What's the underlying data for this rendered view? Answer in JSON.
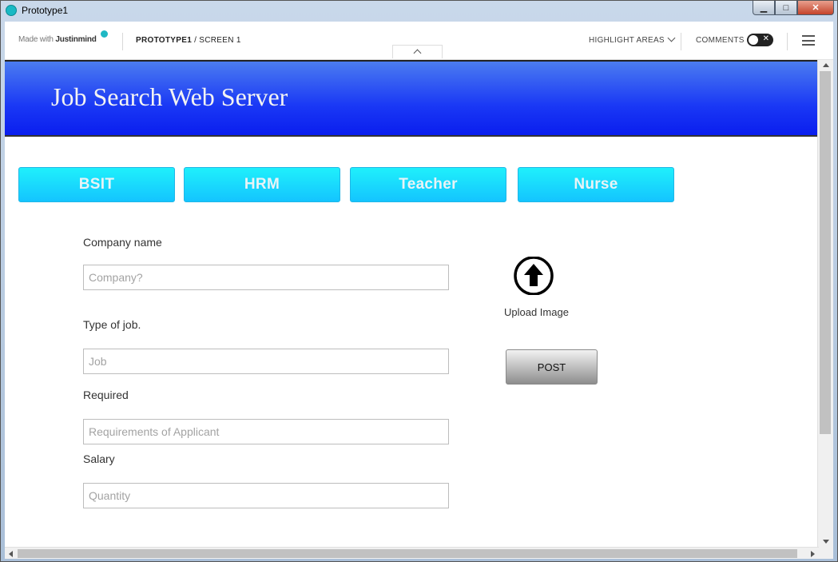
{
  "window": {
    "title": "Prototype1",
    "minimize_glyph": "▁",
    "maximize_glyph": "□",
    "close_glyph": "✕"
  },
  "toolbar": {
    "made_with": "Made with ",
    "brand": "Justinmind",
    "crumb_project": "PROTOTYPE1",
    "crumb_screen": " / SCREEN 1",
    "highlight_areas": "HIGHLIGHT AREAS",
    "comments": "COMMENTS",
    "toggle_glyph": "✕"
  },
  "banner": {
    "title": "Job Search Web Server"
  },
  "categories": [
    "BSIT",
    "HRM",
    "Teacher",
    "Nurse"
  ],
  "form": {
    "company_label": "Company name",
    "company_placeholder": "Company?",
    "job_label": "Type of job.",
    "job_placeholder": "Job",
    "required_label": "Required",
    "required_placeholder": "Requirements of Applicant",
    "salary_label": "Salary",
    "salary_placeholder": "Quantity"
  },
  "upload": {
    "label": "Upload Image"
  },
  "post_button": {
    "label": "POST"
  },
  "colors": {
    "banner_blue": "#1a38f5",
    "category_cyan": "#14c4ff",
    "brand_teal": "#1fb8c4"
  }
}
